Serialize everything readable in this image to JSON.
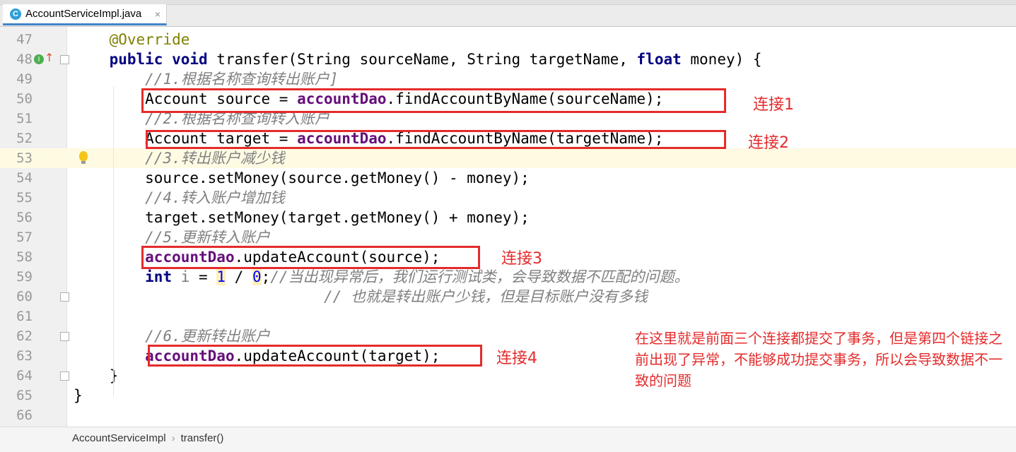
{
  "tab": {
    "icon_letter": "C",
    "title": "AccountServiceImpl.java",
    "close": "×"
  },
  "code_lines": [
    {
      "num": "47",
      "html": "    <span class='ann'>@Override</span>"
    },
    {
      "num": "48",
      "html": "    <span class='kw'>public void</span> transfer(String sourceName, String targetName, <span class='kw'>float</span> money) {"
    },
    {
      "num": "49",
      "html": "        <span class='cmt'>//1.根据名称查询转出账户]</span>"
    },
    {
      "num": "50",
      "html": "        Account source = <span class='fld'>accountDao</span>.findAccountByName(sourceName);"
    },
    {
      "num": "51",
      "html": "        <span class='cmt'>//2.根据名称查询转入账户</span>"
    },
    {
      "num": "52",
      "html": "        Account target = <span class='fld'>accountDao</span>.findAccountByName(targetName);"
    },
    {
      "num": "53",
      "html": "        <span class='cmt'>//3.转出账户减少钱</span>"
    },
    {
      "num": "54",
      "html": "        source.setMoney(source.getMoney() - money);"
    },
    {
      "num": "55",
      "html": "        <span class='cmt'>//4.转入账户增加钱</span>"
    },
    {
      "num": "56",
      "html": "        target.setMoney(target.getMoney() + money);"
    },
    {
      "num": "57",
      "html": "        <span class='cmt'>//5.更新转入账户</span>"
    },
    {
      "num": "58",
      "html": "        <span class='fld'>accountDao</span>.updateAccount(source);"
    },
    {
      "num": "59",
      "html": "        <span class='kw'>int</span> <span class='unused'>i</span> = <span class='num'>1</span> / <span class='num'>0</span>;<span class='cmt'>//当出现异常后，我们运行测试类，会导致数据不匹配的问题。</span>"
    },
    {
      "num": "60",
      "html": "                            <span class='cmt'>// 也就是转出账户少钱，但是目标账户没有多钱</span>"
    },
    {
      "num": "61",
      "html": ""
    },
    {
      "num": "62",
      "html": "        <span class='cmt'>//6.更新转出账户</span>"
    },
    {
      "num": "63",
      "html": "        <span class='fld'>accountDao</span>.updateAccount(target);"
    },
    {
      "num": "64",
      "html": "    }"
    },
    {
      "num": "65",
      "html": "}"
    },
    {
      "num": "66",
      "html": ""
    }
  ],
  "current_line": "53",
  "annotations": {
    "conn1": "连接1",
    "conn2": "连接2",
    "conn3": "连接3",
    "conn4": "连接4",
    "note": "在这里就是前面三个连接都提交了事务，但是第四个链接之前出现了异常，不能够成功提交事务，所以会导致数据不一致的问题"
  },
  "breadcrumb": {
    "class_name": "AccountServiceImpl",
    "separator": "›",
    "method": "transfer()"
  },
  "colors": {
    "annotation_red": "#e52b2b",
    "keyword": "#000080",
    "field": "#660e7a",
    "comment": "#808080",
    "annotation": "#808000"
  }
}
